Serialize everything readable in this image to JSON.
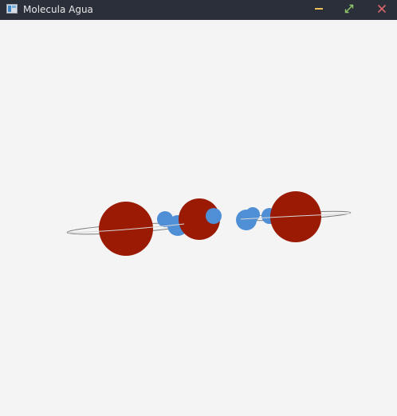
{
  "window": {
    "title": "Molecula Agua",
    "icon": "app-window-icon",
    "controls": {
      "minimize_icon": "minimize-icon",
      "maximize_icon": "maximize-icon",
      "close_icon": "close-icon"
    }
  },
  "scene": {
    "background": "#f4f4f4",
    "colors": {
      "oxygen": "#9b1a04",
      "hydrogen": "#4e8fd6",
      "orbit": "#7d7d7d"
    },
    "atoms": [
      {
        "element": "oxygen",
        "label": "oxygen-atom-1"
      },
      {
        "element": "hydrogen",
        "label": "hydrogen-atom-1"
      },
      {
        "element": "hydrogen",
        "label": "hydrogen-atom-2"
      },
      {
        "element": "oxygen",
        "label": "oxygen-atom-2"
      },
      {
        "element": "hydrogen",
        "label": "hydrogen-atom-3"
      },
      {
        "element": "hydrogen",
        "label": "hydrogen-atom-4"
      },
      {
        "element": "hydrogen",
        "label": "hydrogen-atom-5"
      },
      {
        "element": "oxygen",
        "label": "oxygen-atom-3"
      }
    ]
  }
}
